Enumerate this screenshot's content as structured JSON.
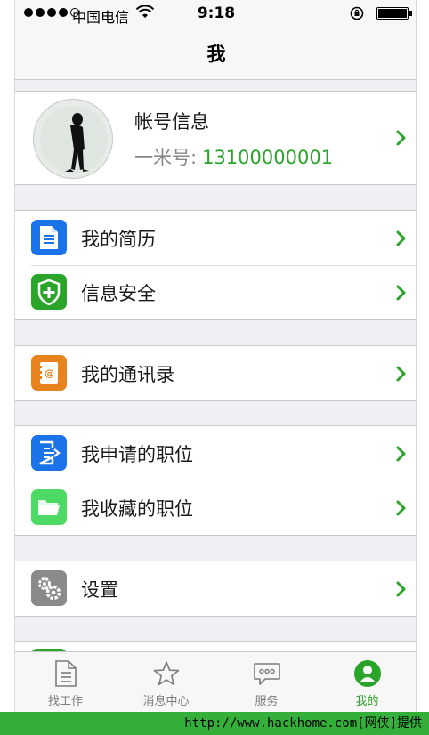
{
  "status_bar": {
    "carrier": "中国电信",
    "time": "9:18"
  },
  "nav": {
    "title": "我"
  },
  "profile": {
    "title": "帐号信息",
    "id_label": "一米号:",
    "id_value": "13100000001"
  },
  "menu": {
    "resume": "我的简历",
    "security": "信息安全",
    "contacts": "我的通讯录",
    "applied": "我申请的职位",
    "favorites": "我收藏的职位",
    "settings": "设置"
  },
  "tabs": [
    {
      "label": "找工作",
      "icon": "document-icon"
    },
    {
      "label": "消息中心",
      "icon": "star-icon"
    },
    {
      "label": "服务",
      "icon": "chat-bubble-icon"
    },
    {
      "label": "我的",
      "icon": "person-icon"
    }
  ],
  "colors": {
    "accent": "#2aa52a",
    "blue": "#1a73e8",
    "green": "#2aa52a",
    "orange": "#e8821c",
    "gray": "#8a8a8a"
  },
  "watermark": "http://www.hackhome.com[网侠]提供"
}
